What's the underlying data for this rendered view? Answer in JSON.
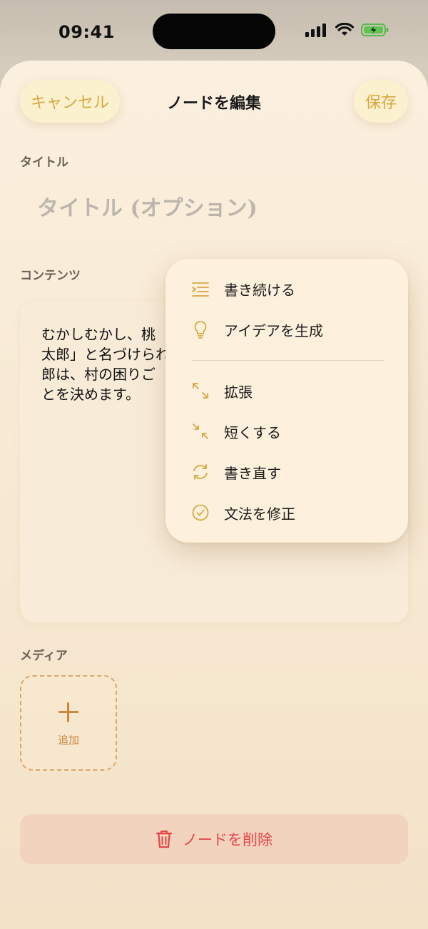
{
  "status_bar": {
    "time": "09:41"
  },
  "header": {
    "cancel_label": "キャンセル",
    "title": "ノードを編集",
    "save_label": "保存"
  },
  "title_section": {
    "label": "タイトル",
    "placeholder": "タイトル (オプション)"
  },
  "content_section": {
    "label": "コンテンツ",
    "text": "むかしむかし、桃\n太郎」と名づけられ\n郎は、村の困りご\nとを決めます。"
  },
  "media_section": {
    "label": "メディア",
    "add_label": "追加"
  },
  "delete_label": "ノードを削除",
  "menu": {
    "items": [
      {
        "label": "書き続ける",
        "icon": "continue-writing-icon"
      },
      {
        "label": "アイデアを生成",
        "icon": "lightbulb-icon"
      },
      {
        "label": "拡張",
        "icon": "expand-icon"
      },
      {
        "label": "短くする",
        "icon": "shrink-icon"
      },
      {
        "label": "書き直す",
        "icon": "rewrite-icon"
      },
      {
        "label": "文法を修正",
        "icon": "checkmark-circle-icon"
      }
    ]
  },
  "colors": {
    "accent": "#d9a742",
    "delete_text": "#e4474a",
    "delete_bg": "#f2d3bd"
  }
}
